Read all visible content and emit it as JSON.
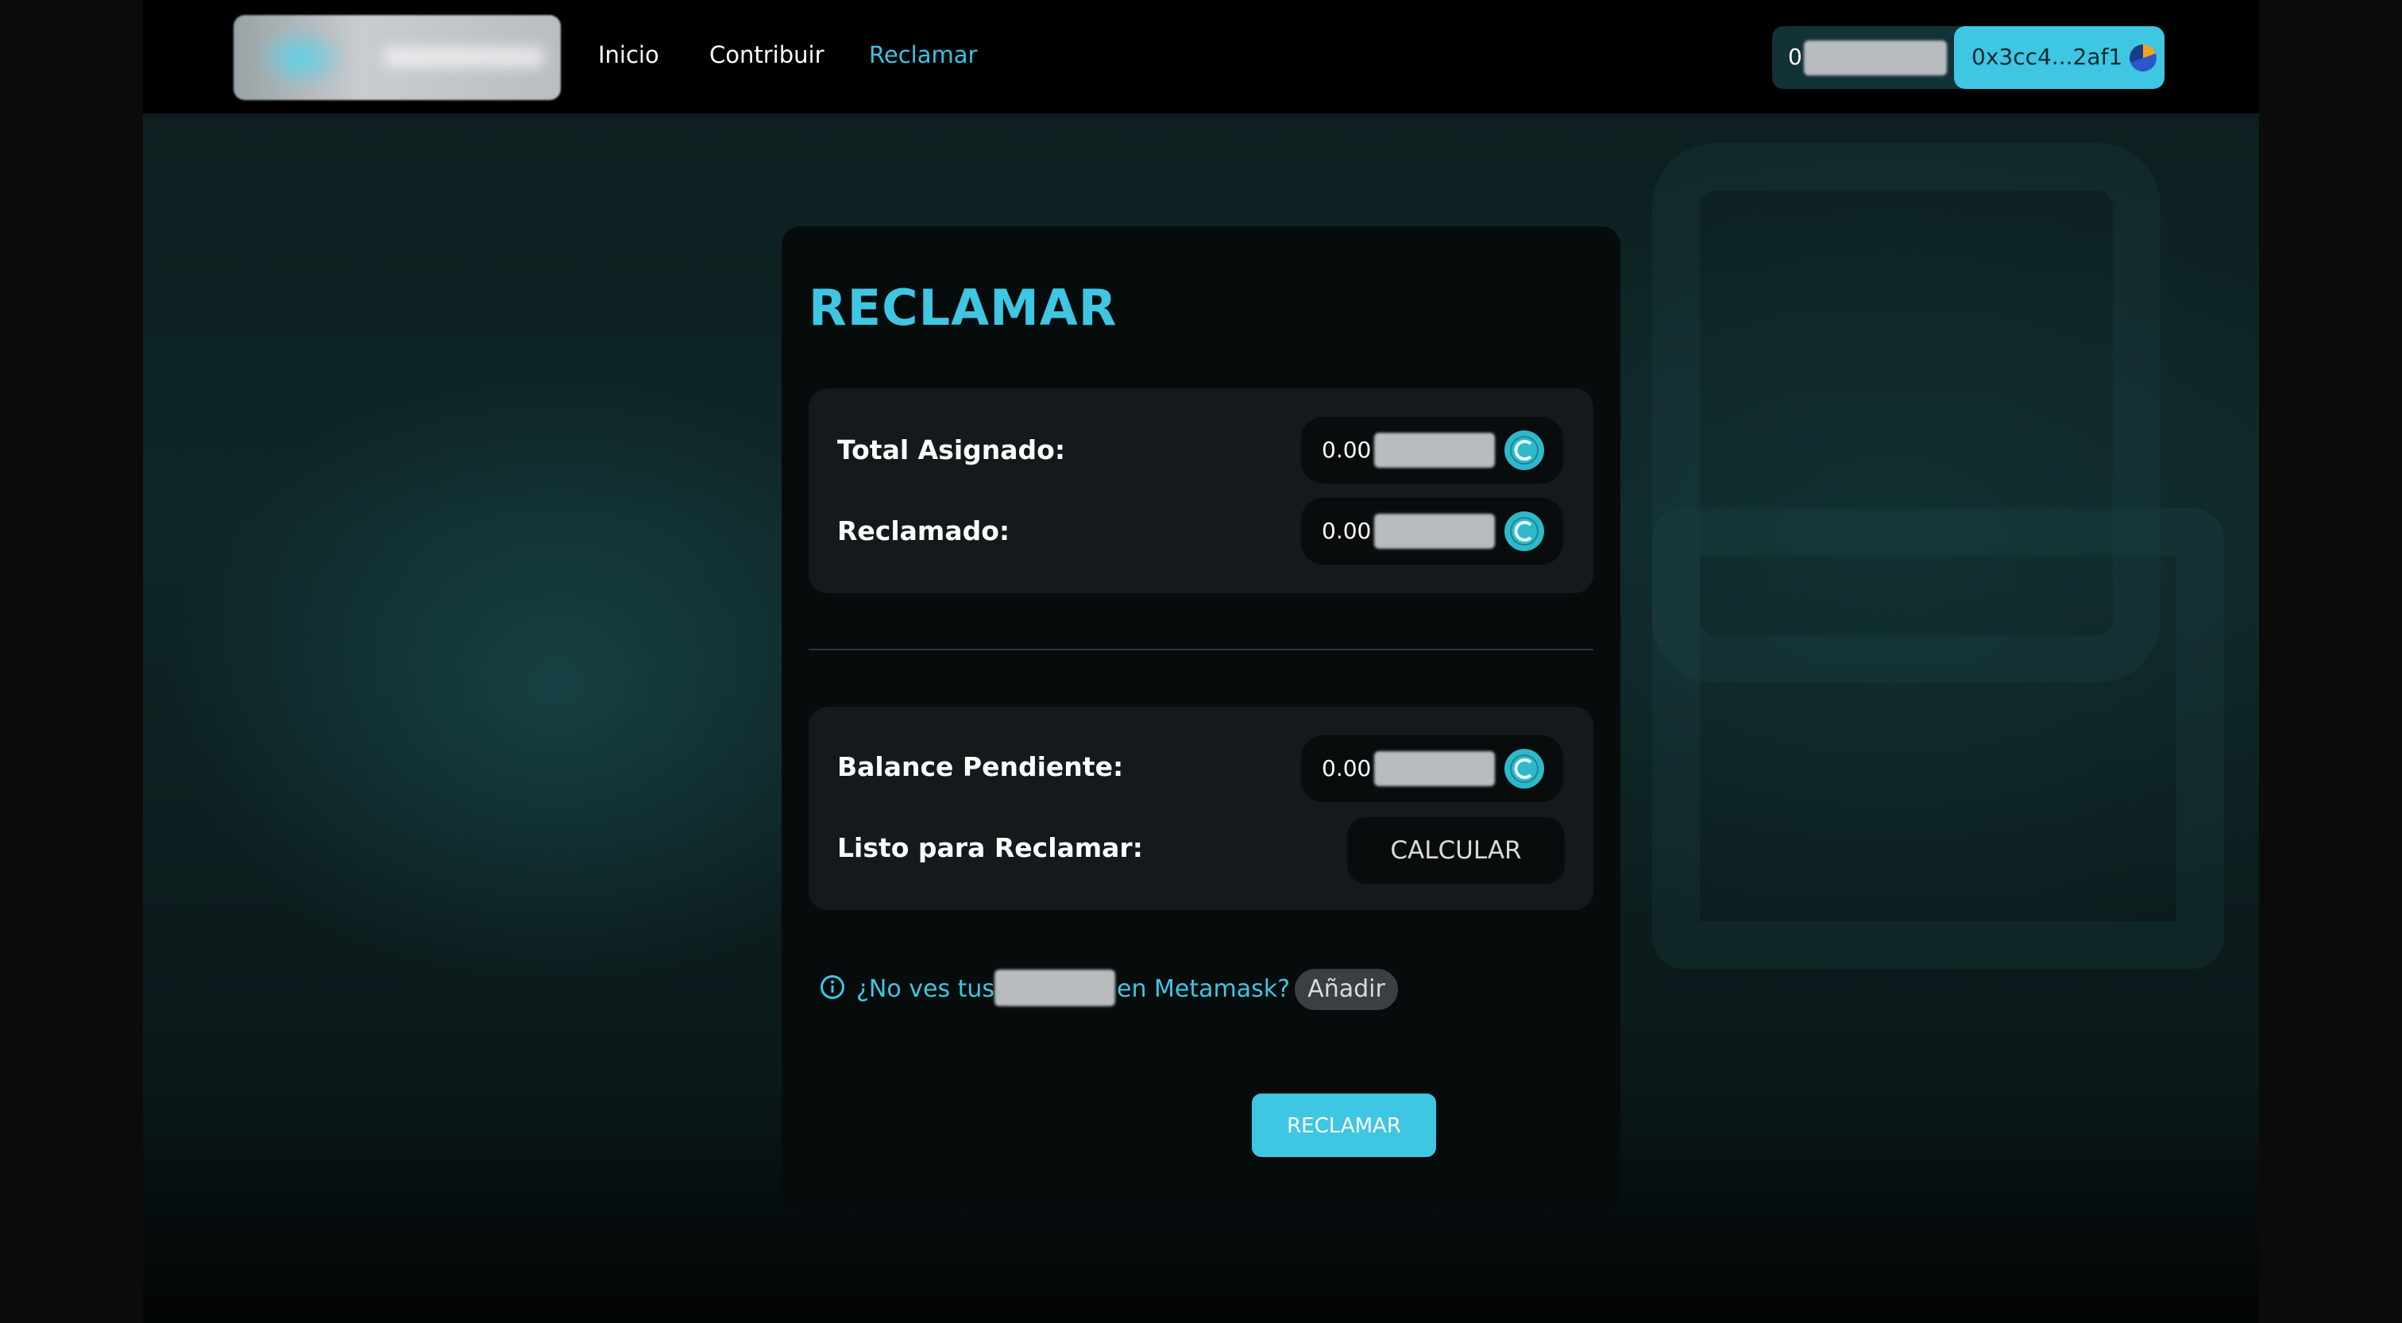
{
  "navbar": {
    "links": [
      {
        "label": "Inicio"
      },
      {
        "label": "Contribuir"
      },
      {
        "label": "Reclamar",
        "active": true
      }
    ],
    "balance_value": "0",
    "wallet_address": "0x3cc4...2af1"
  },
  "card": {
    "title": "RECLAMAR",
    "allocation_panel": {
      "total_assigned_label": "Total Asignado:",
      "total_assigned_value": "0.00",
      "claimed_label": "Reclamado:",
      "claimed_value": "0.00"
    },
    "pending_panel": {
      "pending_balance_label": "Balance Pendiente:",
      "pending_balance_value": "0.00",
      "ready_label": "Listo para Reclamar:",
      "calculate_button": "CALCULAR"
    },
    "metamask_hint": {
      "text_before": "¿No ves tus",
      "text_after": "en Metamask?",
      "add_button": "Añadir"
    },
    "claim_button": "RECLAMAR"
  },
  "colors": {
    "accent": "#3ec6e3",
    "navbar_bg": "#000000",
    "card_bg": "#060b0c",
    "panel_bg": "#14191b",
    "token_icon": "#2fb8c9"
  },
  "icons": [
    "logo",
    "token-icon",
    "info-icon",
    "wallet-avatar-icon"
  ]
}
